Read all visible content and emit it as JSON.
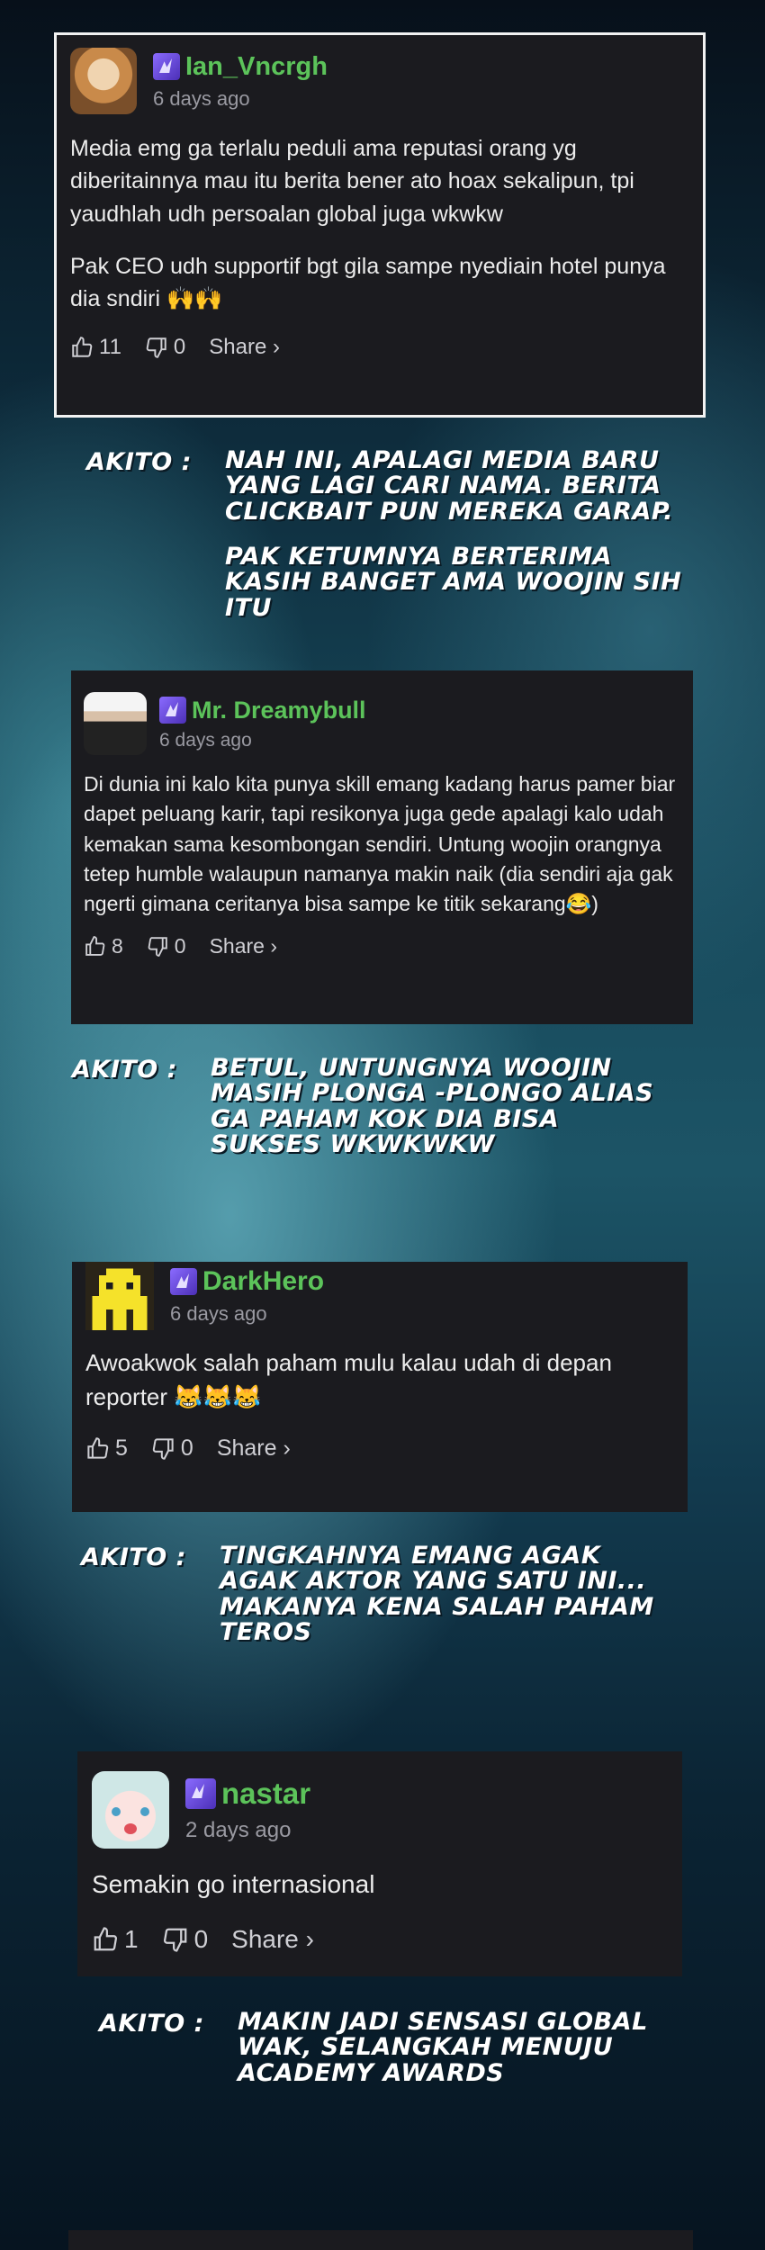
{
  "comments": [
    {
      "username": "Ian_Vncrgh",
      "time": "6 days ago",
      "paragraphs": [
        "Media emg ga terlalu peduli ama reputasi orang yg diberitainnya mau itu berita bener ato hoax sekalipun, tpi yaudhlah udh persoalan global juga wkwkw",
        "Pak CEO udh supportif bgt gila sampe nyediain hotel punya dia sndiri 🙌🙌"
      ],
      "likes": "11",
      "dislikes": "0",
      "share_label": "Share ›"
    },
    {
      "username": "Mr. Dreamybull",
      "time": "6 days ago",
      "paragraphs": [
        "Di dunia ini kalo kita punya skill emang kadang harus pamer biar dapet peluang karir, tapi resikonya juga gede apalagi kalo udah kemakan sama kesombongan sendiri. Untung woojin orangnya tetep humble walaupun namanya makin naik (dia sendiri aja gak ngerti gimana ceritanya bisa sampe ke titik sekarang😂)"
      ],
      "likes": "8",
      "dislikes": "0",
      "share_label": "Share ›"
    },
    {
      "username": "DarkHero",
      "time": "6 days ago",
      "paragraphs": [
        "Awoakwok salah paham mulu kalau udah di depan reporter 😹😹😹"
      ],
      "likes": "5",
      "dislikes": "0",
      "share_label": "Share ›"
    },
    {
      "username": "nastar",
      "time": "2 days ago",
      "paragraphs": [
        "Semakin go internasional"
      ],
      "likes": "1",
      "dislikes": "0",
      "share_label": "Share ›"
    }
  ],
  "notes": [
    {
      "speaker": "AKITO :",
      "paragraphs": [
        "NAH INI, APALAGI MEDIA BARU YANG LAGI CARI NAMA. BERITA CLICKBAIT PUN MEREKA GARAP.",
        "PAK KETUMNYA BERTERIMA KASIH BANGET AMA WOOJIN SIH ITU"
      ]
    },
    {
      "speaker": "AKITO :",
      "paragraphs": [
        "BETUL, UNTUNGNYA WOOJIN MASIH PLONGA -PLONGO ALIAS GA PAHAM KOK DIA BISA SUKSES WKWKWKW"
      ]
    },
    {
      "speaker": "AKITO :",
      "paragraphs": [
        "TINGKAHNYA EMANG AGAK AGAK AKTOR YANG SATU INI... MAKANYA KENA SALAH PAHAM TEROS"
      ]
    },
    {
      "speaker": "AKITO :",
      "paragraphs": [
        "MAKIN JADI SENSASI GLOBAL WAK, SELANGKAH MENUJU ACADEMY AWARDS"
      ]
    }
  ],
  "colors": {
    "username": "#5cc35a",
    "card_bg": "#1b1b1f",
    "muted": "#9a9aa2"
  }
}
